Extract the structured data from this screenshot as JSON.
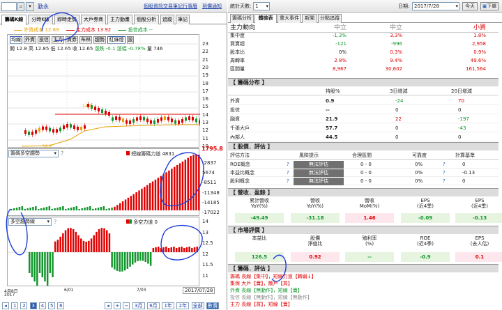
{
  "left": {
    "stock_name": "勤永",
    "toplinks": [
      "個股資訊",
      "交易筆記",
      "行事曆",
      "到價通知"
    ],
    "tabs": [
      "籌碼K線",
      "分時K線",
      "即時走勢",
      "大戶券商",
      "主力動畫",
      "個股分析",
      "追蹤",
      "筆記"
    ],
    "legend": [
      "外資成本 12.69",
      "主力成本 13.92",
      "投信成本 --"
    ],
    "buttons": [
      "均線",
      "外資",
      "投信",
      "主力",
      "資券",
      "布林",
      "趨勢",
      "紅綠燈",
      "設"
    ],
    "ohlc": "開 12.8  高 12.85  低 12.65  收 12.65",
    "chg": "漲跌 -0.1",
    "pct": "漲幅 -0.78%",
    "vol": "量 746",
    "main_ticks": [
      "23",
      "22",
      "21",
      "20",
      "19",
      "18",
      "17",
      "16",
      "15",
      "14",
      "13",
      "12",
      "11",
      "10"
    ],
    "high_label": "14.4",
    "low_label": "10.8",
    "ind1_select": "籌碼多空趨勢",
    "ind1_legend": "短線籌碼力道 4831",
    "ind1_value": "1795.8",
    "ind1_ticks": [
      "-2837",
      "5674",
      "-8511",
      "-11348",
      "-14185",
      "-17022"
    ],
    "ind2_select": "多空趨勢線",
    "ind2_legend": "多空力道 0",
    "ind2_ticks": [
      "14",
      "13",
      "12.5",
      "12",
      "11.5",
      "11"
    ],
    "x_labels": [
      "6/01",
      "7/03"
    ],
    "date_left": "4月8日",
    "year": "2017",
    "date_right": "2017/07/28",
    "pages": [
      "1",
      "2",
      "3",
      "4",
      "5",
      "6"
    ],
    "ranges": [
      "3月",
      "6月",
      "1年",
      "2年",
      "全部",
      "數價"
    ]
  },
  "right": {
    "stat_days_label": "統計天數:",
    "stat_days": "1",
    "date_label": "日期:",
    "date": "2017/7/28",
    "today": "今天",
    "buy_btn": "下單",
    "tabs": [
      "籌碼分析",
      "體檢表",
      "重大事件",
      "新聞",
      "分點追蹤"
    ],
    "top_rows": [
      {
        "label": "主力動向",
        "a": "中立",
        "b": "中立",
        "c": "小買"
      },
      {
        "label": "集中度",
        "a": "-1.3%",
        "b": "3.3%",
        "c": "1.8%"
      },
      {
        "label": "買賣超",
        "a": "-121",
        "b": "-996",
        "c": "2,958"
      },
      {
        "label": "股本比",
        "a": "0%",
        "b": "0.3%",
        "c": "0.9%"
      },
      {
        "label": "周轉率",
        "a": "2.8%",
        "b": "9.4%",
        "c": "49.6%"
      },
      {
        "label": "區間量",
        "a": "8,967",
        "b": "30,602",
        "c": "161,564"
      }
    ],
    "sec_chip": "【 籌碼分布 】",
    "chip_head": [
      "持股%",
      "3日增減",
      "20日增減"
    ],
    "chip_rows": [
      {
        "label": "外資",
        "a": "0.9",
        "b": "-24",
        "c": "70"
      },
      {
        "label": "投信",
        "a": "--",
        "b": "0",
        "c": "0"
      },
      {
        "label": "融資",
        "a": "21.9",
        "b": "22",
        "c": "-197"
      },
      {
        "label": "千張大戶",
        "a": "57.7",
        "b": "0",
        "c": "-43"
      },
      {
        "label": "內部人",
        "a": "44.5",
        "b": "0",
        "c": "0"
      }
    ],
    "sec_eval": "【 股價．評估 】",
    "eval_head": [
      "評估方法",
      "風險提示",
      "合理區間",
      "可靠度",
      "計算基準"
    ],
    "eval_rows": [
      {
        "label": "ROE概念",
        "risk": "無法評估",
        "range": "0 - 0",
        "rel": "0%",
        "base": "0"
      },
      {
        "label": "本益比概念",
        "risk": "無法評估",
        "range": "0 - 0",
        "rel": "0%",
        "base": "-0.13"
      },
      {
        "label": "股利概念",
        "risk": "無法評估",
        "range": "0 - 0",
        "rel": "0%",
        "base": "0"
      }
    ],
    "sec_rev": "【 營收．盈餘 】",
    "rev_head": [
      "累計營收\nYoY(%)",
      "營收\nYoY(%)",
      "營收\nMoM(%)",
      "EPS\n(近4季)",
      "EPS\n(近4季)"
    ],
    "rev_vals": [
      "-49.49",
      "-31.18",
      "1.46",
      "-0.09",
      "-0.13"
    ],
    "sec_val": "【 市場評價 】",
    "val_head": [
      "本益比",
      "股價\n淨值比",
      "殖利率\n(%)",
      "ROE\n(近4季)",
      "EPS\n(去人估)"
    ],
    "val_vals": [
      "126.5",
      "0.92",
      "--",
      "-0.9",
      "0.1"
    ],
    "sec_chip2": "【 籌碼．評估 】",
    "notes": [
      "籌碼 長線【集中】，短線力道【轉弱↓】",
      "集保 大戶【賣】，散戶【買】",
      "外資 長線【無動作】，短線【賣】",
      "投信 長線【無動作】，短線【無動作】",
      "主力 長線【買】，短線【賣】"
    ]
  },
  "colors": {
    "red": "#e00000",
    "green": "#11962b",
    "blue_link": "#1a3ea8"
  }
}
